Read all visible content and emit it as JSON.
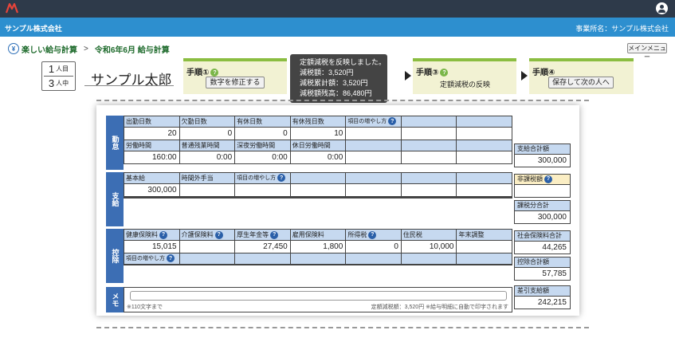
{
  "header": {
    "company": "サンプル株式会社",
    "office": "事業所名：サンプル株式会社"
  },
  "breadcrumb": {
    "app": "楽しい給与計算",
    "page": "令和6年6月 給与計算",
    "separator": ">"
  },
  "menu_button": "メインメニュー",
  "employee": {
    "current": "1",
    "current_unit": "人目",
    "total": "3",
    "total_unit": "人中",
    "name": "サンプル太郎"
  },
  "steps": [
    {
      "title": "手順①",
      "button": "数字を修正する"
    },
    {
      "title": "手順③",
      "text": "定額減税の反映"
    },
    {
      "title": "手順④",
      "button": "保存して次の人へ"
    }
  ],
  "tooltip": [
    "定額減税を反映しました。",
    "減税額：3,520円",
    "減税累計額：3,520円",
    "減税額残高：86,480円"
  ],
  "sections": {
    "attendance": "勤怠",
    "pay": "支給",
    "deduction": "控除",
    "memo": "メモ"
  },
  "attendance": {
    "row1_headers": [
      "出勤日数",
      "欠勤日数",
      "有休日数",
      "有休残日数",
      "項目の増やし方",
      "",
      ""
    ],
    "row1_values": [
      "20",
      "0",
      "0",
      "10",
      "",
      "",
      ""
    ],
    "row2_headers": [
      "労働時間",
      "普通残業時間",
      "深夜労働時間",
      "休日労働時間",
      "",
      "",
      ""
    ],
    "row2_values": [
      "160:00",
      "0:00",
      "0:00",
      "0:00",
      "",
      "",
      ""
    ]
  },
  "pay": {
    "row1_headers": [
      "基本給",
      "時間外手当",
      "項目の増やし方",
      "",
      "",
      "",
      ""
    ],
    "row1_values": [
      "300,000",
      "",
      "",
      "",
      "",
      "",
      ""
    ],
    "row2_headers": [
      "",
      "",
      "",
      "",
      "",
      "",
      ""
    ],
    "row2_values": [
      "",
      "",
      "",
      "",
      "",
      "",
      ""
    ]
  },
  "deduction": {
    "row1_headers": [
      "健康保険料",
      "介護保険料",
      "厚生年金等",
      "雇用保険料",
      "所得税",
      "住民税",
      "年末調整"
    ],
    "row1_values": [
      "15,015",
      "",
      "27,450",
      "1,800",
      "0",
      "10,000",
      ""
    ],
    "row2_headers": [
      "項目の増やし方",
      "",
      "",
      "",
      "",
      "",
      ""
    ],
    "row2_values": [
      "",
      "",
      "",
      "",
      "",
      "",
      ""
    ]
  },
  "summary": {
    "pay_total_label": "支給合計額",
    "pay_total": "300,000",
    "nontax_label": "非課税額",
    "nontax": "",
    "taxable_label": "課税分合計",
    "taxable": "300,000",
    "social_label": "社会保険料合計",
    "social": "44,265",
    "deduct_label": "控除合計額",
    "deduct": "57,785",
    "net_label": "差引支給額",
    "net": "242,215"
  },
  "memo": {
    "hint": "※110文字まで",
    "note": "定額減税額：3,520円 ※給与明細に自動で印字されます"
  },
  "colors": {
    "topbar": "#2e3a4a",
    "company_bar": "#2d8fcf",
    "step_accent": "#8bbd41",
    "section_label": "#3c6eb4",
    "header_cell": "#c6d9f0"
  }
}
